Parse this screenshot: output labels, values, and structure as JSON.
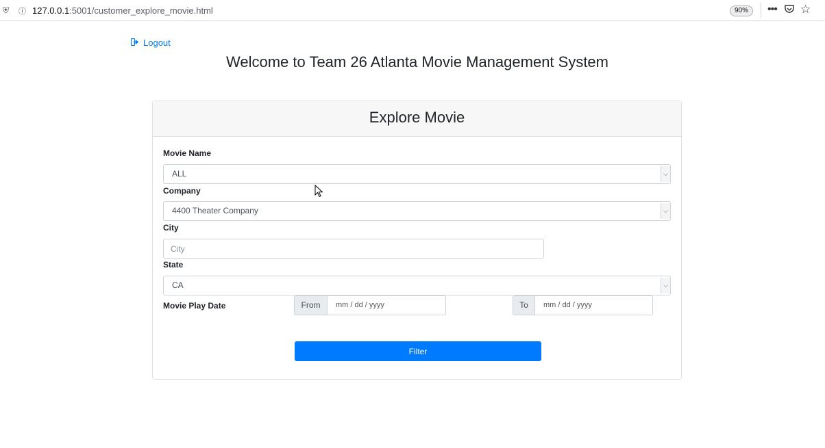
{
  "browser": {
    "url_host": "127.0.0.1",
    "url_path": ":5001/customer_explore_movie.html",
    "zoom": "90%",
    "icons": [
      "shield-icon",
      "info-icon",
      "more-icon",
      "pocket-icon",
      "star-icon"
    ]
  },
  "header": {
    "logout_label": "Logout",
    "welcome": "Welcome to Team 26 Atlanta Movie Management System"
  },
  "card": {
    "title": "Explore Movie"
  },
  "form": {
    "movie_name_label": "Movie Name",
    "movie_name_value": "ALL",
    "company_label": "Company",
    "company_value": "4400 Theater Company",
    "city_label": "City",
    "city_placeholder": "City",
    "state_label": "State",
    "state_value": "CA",
    "play_date_label": "Movie Play Date",
    "from_label": "From",
    "from_placeholder": "mm / dd / yyyy",
    "to_label": "To",
    "to_placeholder": "mm / dd / yyyy",
    "filter_label": "Filter"
  },
  "colors": {
    "primary": "#007bff",
    "card_header_bg": "#f7f7f7",
    "addon_bg": "#e9ecef"
  }
}
